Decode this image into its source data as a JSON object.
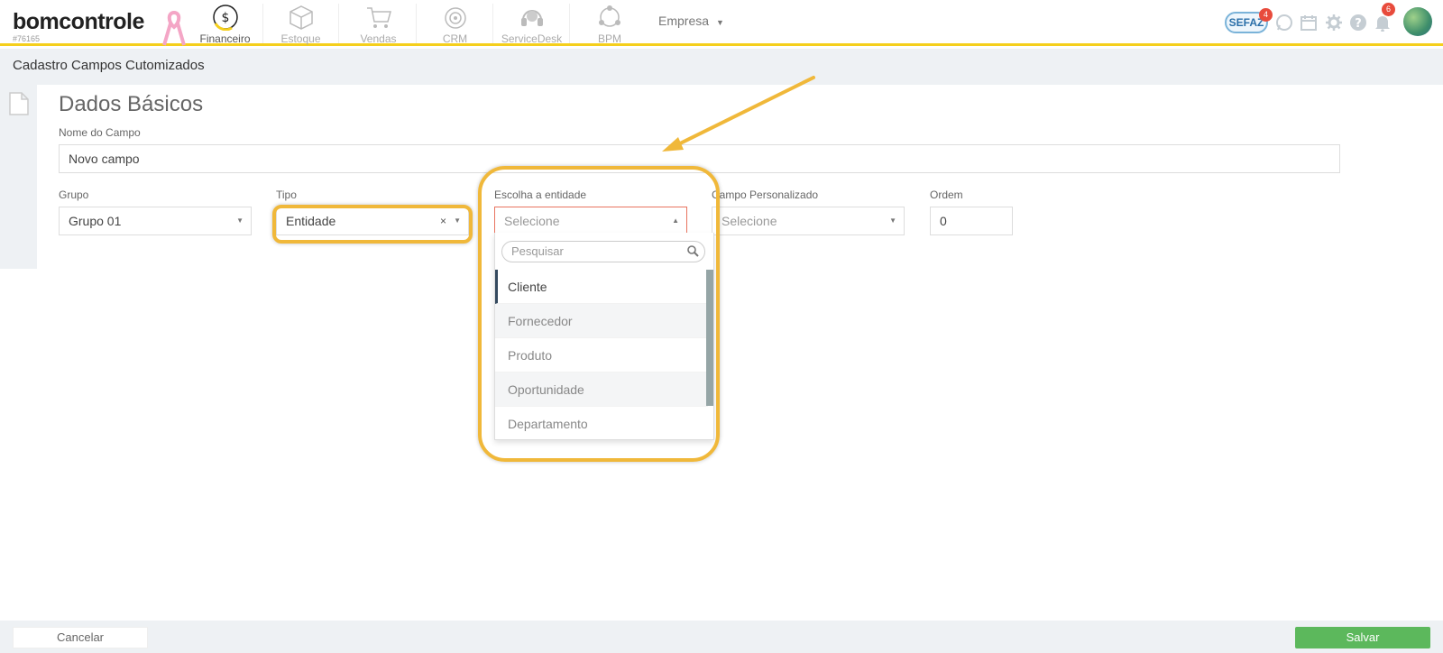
{
  "brand": {
    "logo": "bomcontrole",
    "account_id": "#76165"
  },
  "nav": {
    "modules": [
      {
        "label": "Financeiro",
        "icon": "dollar-coin-icon",
        "active": true
      },
      {
        "label": "Estoque",
        "icon": "box-icon",
        "active": false
      },
      {
        "label": "Vendas",
        "icon": "cart-icon",
        "active": false
      },
      {
        "label": "CRM",
        "icon": "target-icon",
        "active": false
      },
      {
        "label": "ServiceDesk",
        "icon": "headset-icon",
        "active": false
      },
      {
        "label": "BPM",
        "icon": "process-icon",
        "active": false
      }
    ],
    "company_menu": "Empresa",
    "sefaz": {
      "label": "SEFAZ",
      "badge": "4"
    },
    "notifications_badge": "6"
  },
  "page": {
    "title": "Cadastro Campos Cutomizados",
    "section_title": "Dados Básicos"
  },
  "form": {
    "nome_label": "Nome do Campo",
    "nome_value": "Novo campo",
    "grupo_label": "Grupo",
    "grupo_value": "Grupo 01",
    "tipo_label": "Tipo",
    "tipo_value": "Entidade",
    "tipo_clear": "×",
    "entidade_label": "Escolha a entidade",
    "entidade_placeholder": "Selecione",
    "campo_label": "Campo Personalizado",
    "campo_placeholder": "Selecione",
    "ordem_label": "Ordem",
    "ordem_value": "0"
  },
  "dropdown": {
    "search_placeholder": "Pesquisar",
    "options": [
      "Cliente",
      "Fornecedor",
      "Produto",
      "Oportunidade",
      "Departamento"
    ]
  },
  "footer": {
    "cancel_label": "Cancelar",
    "save_label": "Salvar"
  },
  "colors": {
    "accent_yellow": "#f5cf1c",
    "highlight": "#f0b83a",
    "save_green": "#5cb85c",
    "error_border": "#e8735f"
  }
}
